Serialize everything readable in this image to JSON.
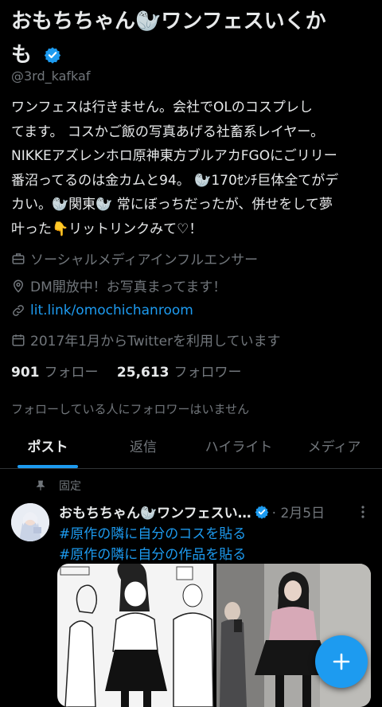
{
  "profile": {
    "name_line1": "おもちちゃん🦭ワンフェスいくか",
    "name_line2": "も",
    "handle": "@3rd_kafkaf",
    "bio": "ワンフェスは行きません。会社でOLのコスプレし\nてます。 コスかご飯の写真あげる社畜系レイヤー。\nNIKKEアズレンホロ原神東方ブルアカFGOにごリリー\n番沼ってるのは金カムと94。 🦭170ｾﾝﾁ巨体全てがデ\nカい。🦭関東🦭 常にぼっちだったが、併せをして夢\n叶った👇リットリンクみて♡！",
    "category": "ソーシャルメディアインフルエンサー",
    "location": "DM開放中！お写真まってます！",
    "website": "lit.link/omochichanroom",
    "joined": "2017年1月からTwitterを利用しています",
    "following_count": "901",
    "following_label": "フォロー",
    "followers_count": "25,613",
    "followers_label": "フォロワー",
    "followers_you_know": "フォローしている人にフォロワーはいません",
    "accent_color": "#1d9bf0"
  },
  "tabs": [
    "ポスト",
    "返信",
    "ハイライト",
    "メディア"
  ],
  "pinned_tweet": {
    "pinned_label": "固定",
    "author": "おもちちゃん🦭ワンフェスい…",
    "date": "· 2月5日",
    "line1": "#原作の隣に自分のコスを貼る",
    "line2": "#原作の隣に自分の作品を貼る"
  },
  "icons": {
    "verified": "verified-badge-icon",
    "briefcase": "briefcase-icon",
    "location": "location-pin-icon",
    "link": "link-icon",
    "calendar": "calendar-icon",
    "pin": "pin-icon",
    "more": "more-dots-icon",
    "compose": "compose-plus-icon"
  }
}
